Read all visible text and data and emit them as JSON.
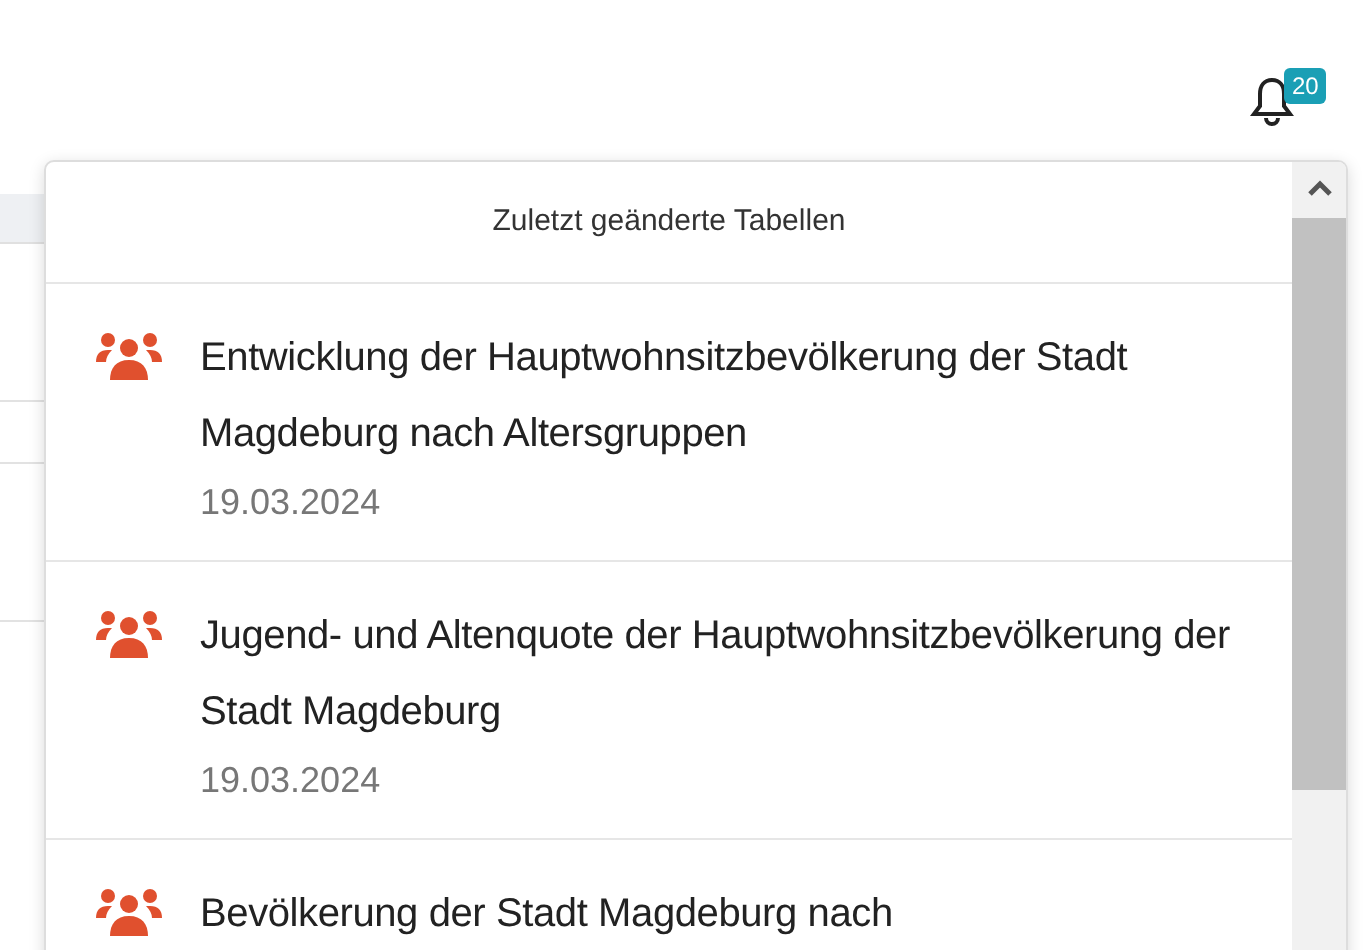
{
  "notifications": {
    "count": "20"
  },
  "panel": {
    "title": "Zuletzt geänderte Tabellen",
    "items": [
      {
        "title": "Entwicklung der Hauptwohnsitzbevölkerung der Stadt Magdeburg nach Altersgruppen",
        "date": "19.03.2024"
      },
      {
        "title": "Jugend- und Altenquote der Hauptwohnsitzbevölkerung der Stadt Magdeburg",
        "date": "19.03.2024"
      },
      {
        "title": "Bevölkerung der Stadt Magdeburg nach"
      }
    ]
  }
}
